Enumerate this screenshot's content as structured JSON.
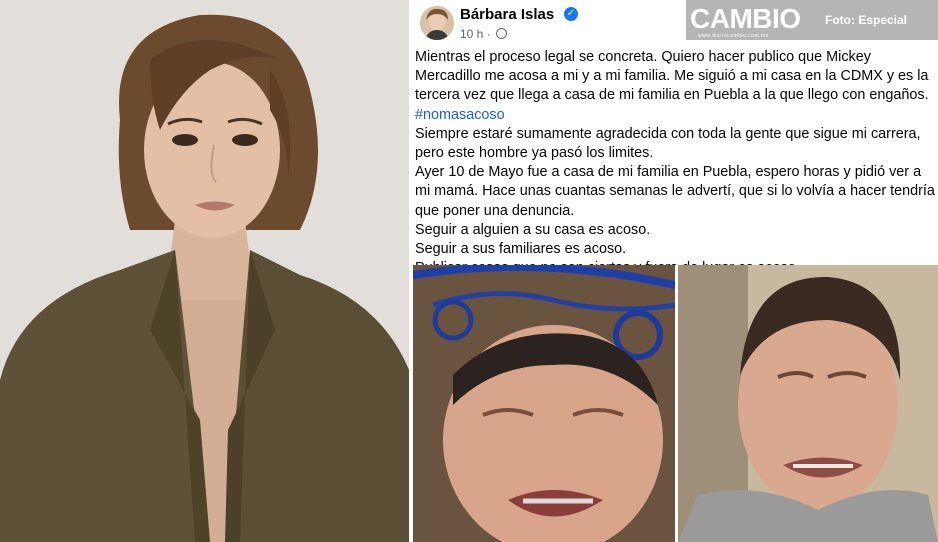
{
  "post": {
    "author": "Bárbara Islas",
    "time": "10 h ·",
    "verified_icon": "check-icon",
    "privacy_icon": "globe-icon",
    "paragraphs": [
      "Mientras el proceso legal se concreta. Quiero hacer publico que Mickey Mercadillo me acosa a mi y a mi familia. Me siguió a mi casa en la CDMX y es la tercera vez que llega a casa de mi familia en Puebla a la que llego con engaños.",
      "Siempre estaré sumamente agradecida con toda la gente que sigue mi carrera, pero este hombre ya pasó los limites.",
      "Ayer 10 de Mayo fue a casa de mi familia en Puebla, espero horas y pidió ver a mi mamá. Hace unas cuantas semanas le advertí, que si lo volvía a hacer tendría que poner una denuncia.",
      "Seguir a alguien a su casa es acoso.",
      "Seguir a sus familiares es acoso.",
      "Publicar cosas que no son ciertas y fuera de lugar es acoso."
    ],
    "hashtag": "#nomasacoso"
  },
  "watermark": {
    "logo": "CAMBIO",
    "logo_sub": "www.diariocambio.com.mx",
    "credit": "Foto: Especial"
  },
  "colors": {
    "link": "#1b61d1",
    "verified": "#1877f2",
    "text": "#050505",
    "meta": "#65676b"
  }
}
